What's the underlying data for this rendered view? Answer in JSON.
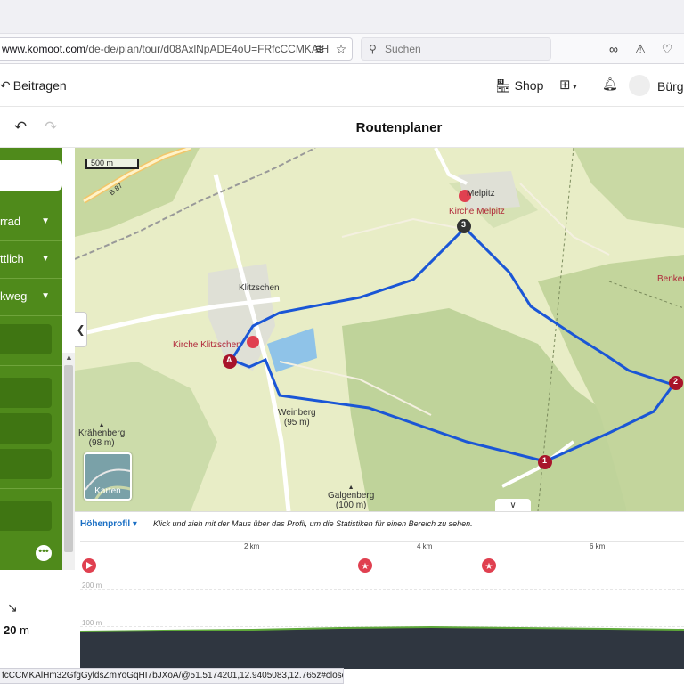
{
  "browser": {
    "url_host": "www.komoot.com",
    "url_path": "/de-de/plan/tour/d08AxlNpADE4oU=FRfcCCMKAlH",
    "search_placeholder": "Suchen",
    "status_url": "fcCCMKAlHm32GfgGyldsZmYoGqHI7bJXoA/@51.5174201,12.9405083,12.765z#close"
  },
  "header": {
    "contribute": "Beitragen",
    "shop": "Shop",
    "user": "Bürg"
  },
  "planner": {
    "title": "Routenplaner"
  },
  "sidebar": {
    "selects": [
      {
        "label": "rrad"
      },
      {
        "label": "ttlich"
      },
      {
        "label": "kweg"
      }
    ],
    "more": "•••",
    "distance_value": "20",
    "distance_unit": "m"
  },
  "map": {
    "scale_label": "500 m",
    "layer_button": "Karten",
    "labels": {
      "b87": "B 87",
      "melpitz": "Melpitz",
      "kirche_melpitz": "Kirche Melpitz",
      "klitzschen": "Klitzschen",
      "kirche_klitzschen": "Kirche Klitzschen",
      "benken": "Benken",
      "kraehenberg": "Krähenberg",
      "kraehenberg_h": "(98 m)",
      "weinberg": "Weinberg",
      "weinberg_h": "(95 m)",
      "galgenberg": "Galgenberg",
      "galgenberg_h": "(100 m)"
    },
    "markers": {
      "start": "A",
      "w1": "1",
      "w2": "2",
      "w3": "3"
    },
    "route_color": "#1a56d6",
    "marker_color": "#a8142a"
  },
  "profile": {
    "title": "Höhenprofil ▾",
    "hint": "Klick und zieh mit der Maus über das Profil, um die Statistiken für einen Bereich zu sehen.",
    "x_ticks": [
      "2 km",
      "4 km",
      "6 km"
    ],
    "y_ticks": [
      "200 m",
      "100 m"
    ]
  }
}
